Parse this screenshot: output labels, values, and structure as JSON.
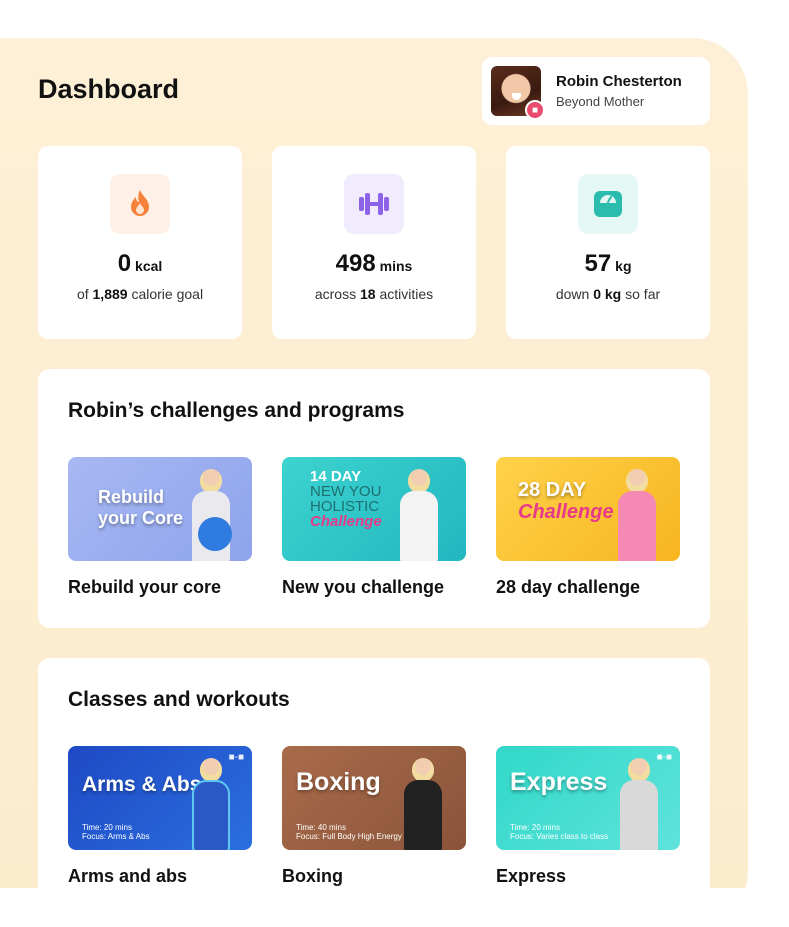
{
  "page": {
    "title": "Dashboard"
  },
  "profile": {
    "name": "Robin Chesterton",
    "subtitle": "Beyond Mother"
  },
  "stats": [
    {
      "icon": "flame-icon",
      "value": "0",
      "unit": "kcal",
      "desc_prefix": "of ",
      "desc_bold": "1,889",
      "desc_suffix": " calorie goal",
      "color": "#f5823a"
    },
    {
      "icon": "dumbbell-icon",
      "value": "498",
      "unit": "mins",
      "desc_prefix": "across ",
      "desc_bold": "18",
      "desc_suffix": " activities",
      "color": "#8c63e6"
    },
    {
      "icon": "scale-icon",
      "value": "57",
      "unit": "kg",
      "desc_prefix": "down ",
      "desc_bold": "0 kg",
      "desc_suffix": " so far",
      "color": "#2bbcae"
    }
  ],
  "challenges": {
    "title": "Robin’s challenges and programs",
    "items": [
      {
        "label": "Rebuild your core",
        "caption_line1": "Rebuild",
        "caption_line2": "your Core"
      },
      {
        "label": "New you challenge",
        "caption_line1": "14 DAY",
        "caption_line2": "NEW YOU",
        "caption_line3": "HOLISTIC",
        "caption_line4": "Challenge"
      },
      {
        "label": "28 day challenge",
        "caption_line1": "28 DAY",
        "caption_line2": "Challenge"
      }
    ]
  },
  "classes": {
    "title": "Classes and workouts",
    "items": [
      {
        "label": "Arms and abs",
        "caption": "Arms & Abs",
        "time": "Time:   20 mins",
        "focus": "Focus:  Arms & Abs"
      },
      {
        "label": "Boxing",
        "caption": "Boxing",
        "time": "Time:   40 mins",
        "focus": "Focus:  Full Body High Energy"
      },
      {
        "label": "Express",
        "caption": "Express",
        "time": "Time:   20 mins",
        "focus": "Focus:  Varies class to class"
      }
    ]
  }
}
